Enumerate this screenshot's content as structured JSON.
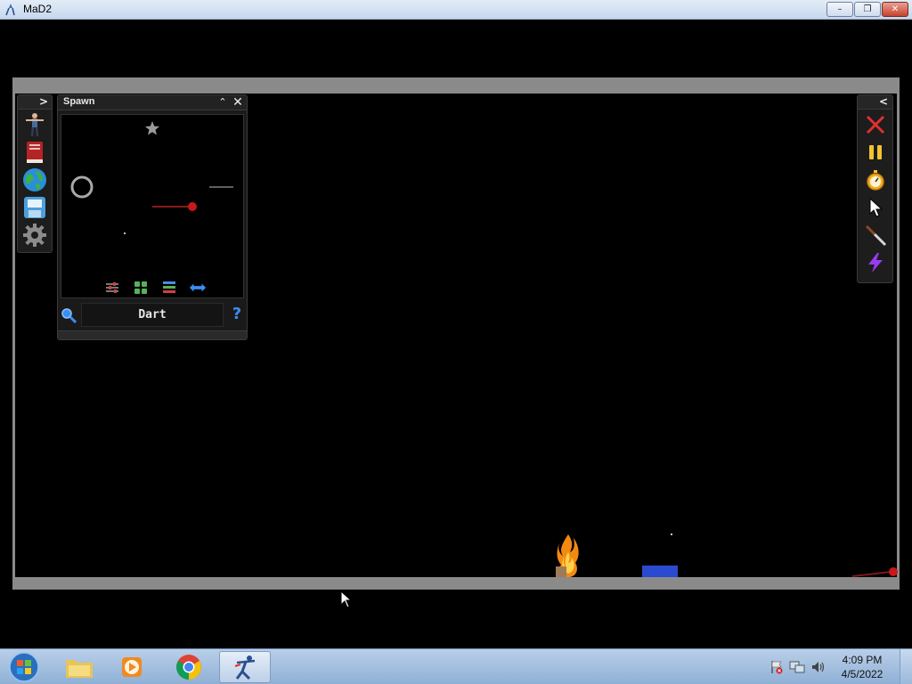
{
  "window": {
    "title": "MaD2",
    "buttons": {
      "minimize": "–",
      "restore": "❐",
      "close": "✕"
    }
  },
  "left_toolbar": {
    "toggle": ">",
    "tools": [
      "ragdoll-icon",
      "book-icon",
      "globe-icon",
      "save-icon",
      "gear-icon"
    ]
  },
  "right_toolbar": {
    "toggle": "<",
    "tools": [
      "clear-icon",
      "pause-icon",
      "stopwatch-icon",
      "pointer-icon",
      "knife-icon",
      "lightning-icon"
    ]
  },
  "spawn_panel": {
    "title": "Spawn",
    "collapse": "⌃",
    "close": "✕",
    "selected_item": "Dart",
    "help": "?"
  },
  "taskbar": {
    "apps": [
      "explorer-icon",
      "media-player-icon",
      "chrome-icon",
      "mad2-icon"
    ],
    "time": "4:09 PM",
    "date": "4/5/2022"
  },
  "colors": {
    "frame": "#8a8a8a",
    "accent_red": "#e03030",
    "accent_yellow": "#f2c230",
    "accent_blue": "#2a4bd0"
  }
}
